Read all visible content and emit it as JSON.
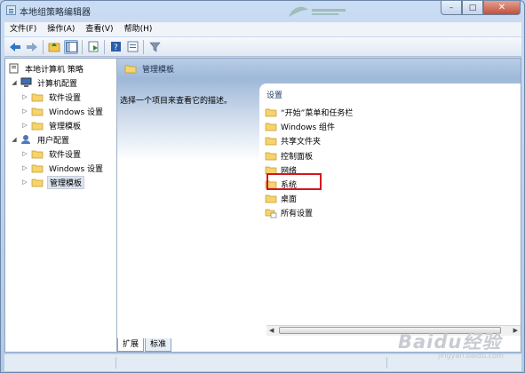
{
  "window": {
    "title": "本地组策略编辑器"
  },
  "menu": [
    {
      "label": "文件(F)"
    },
    {
      "label": "操作(A)"
    },
    {
      "label": "查看(V)"
    },
    {
      "label": "帮助(H)"
    }
  ],
  "tree": {
    "root": "本地计算机 策略",
    "computer_config": "计算机配置",
    "computer_children": [
      "软件设置",
      "Windows 设置",
      "管理模板"
    ],
    "user_config": "用户配置",
    "user_children": [
      "软件设置",
      "Windows 设置",
      "管理模板"
    ]
  },
  "main": {
    "header_title": "管理模板",
    "description": "选择一个项目来查看它的描述。",
    "column_header": "设置",
    "items": [
      "“开始”菜单和任务栏",
      "Windows 组件",
      "共享文件夹",
      "控制面板",
      "网络",
      "系统",
      "桌面",
      "所有设置"
    ],
    "highlighted_item": "控制面板"
  },
  "tabs": [
    {
      "label": "扩展"
    },
    {
      "label": "标准"
    }
  ],
  "watermark": {
    "brand": "Baidu经验",
    "url": "jingyan.baidu.com"
  },
  "colors": {
    "folder": "#f6d36c",
    "highlight": "#d7141e",
    "header": "#a9c1e0"
  }
}
